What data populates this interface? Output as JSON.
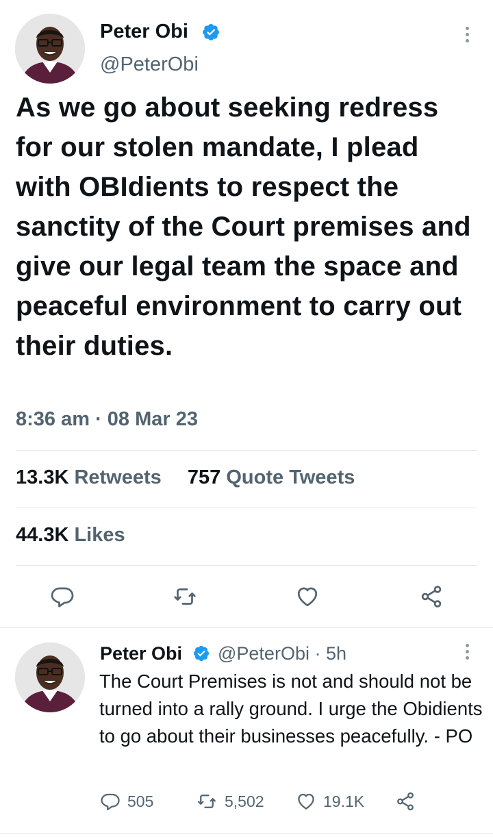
{
  "main_tweet": {
    "author": {
      "name": "Peter Obi",
      "handle": "@PeterObi",
      "verified": true,
      "avatar_icon": "profile-photo"
    },
    "text": "As we go about seeking redress for our stolen mandate, I plead with OBIdients to respect the sanctity of the Court premises and give our legal team the space and peaceful environment to carry out their duties.",
    "timestamp": "8:36 am · 08 Mar 23",
    "stats": {
      "retweets_count": "13.3K",
      "retweets_label": "Retweets",
      "quotes_count": "757",
      "quotes_label": "Quote Tweets",
      "likes_count": "44.3K",
      "likes_label": "Likes"
    },
    "actions": {
      "reply_icon": "speech-bubble-icon",
      "retweet_icon": "retweet-icon",
      "like_icon": "heart-icon",
      "share_icon": "share-icon"
    }
  },
  "reply_tweet": {
    "author": {
      "name": "Peter Obi",
      "handle": "@PeterObi",
      "verified": true
    },
    "meta": "· 5h",
    "text": "The Court Premises is not and should not be turned into a rally ground. I urge the Obidients to go about their businesses peacefully.  - PO",
    "actions": {
      "replies": "505",
      "retweets": "5,502",
      "likes": "19.1K"
    }
  },
  "colors": {
    "text": "#0f1419",
    "secondary": "#536471",
    "verified_blue": "#1d9bf0",
    "divider": "#e4e7ea"
  }
}
